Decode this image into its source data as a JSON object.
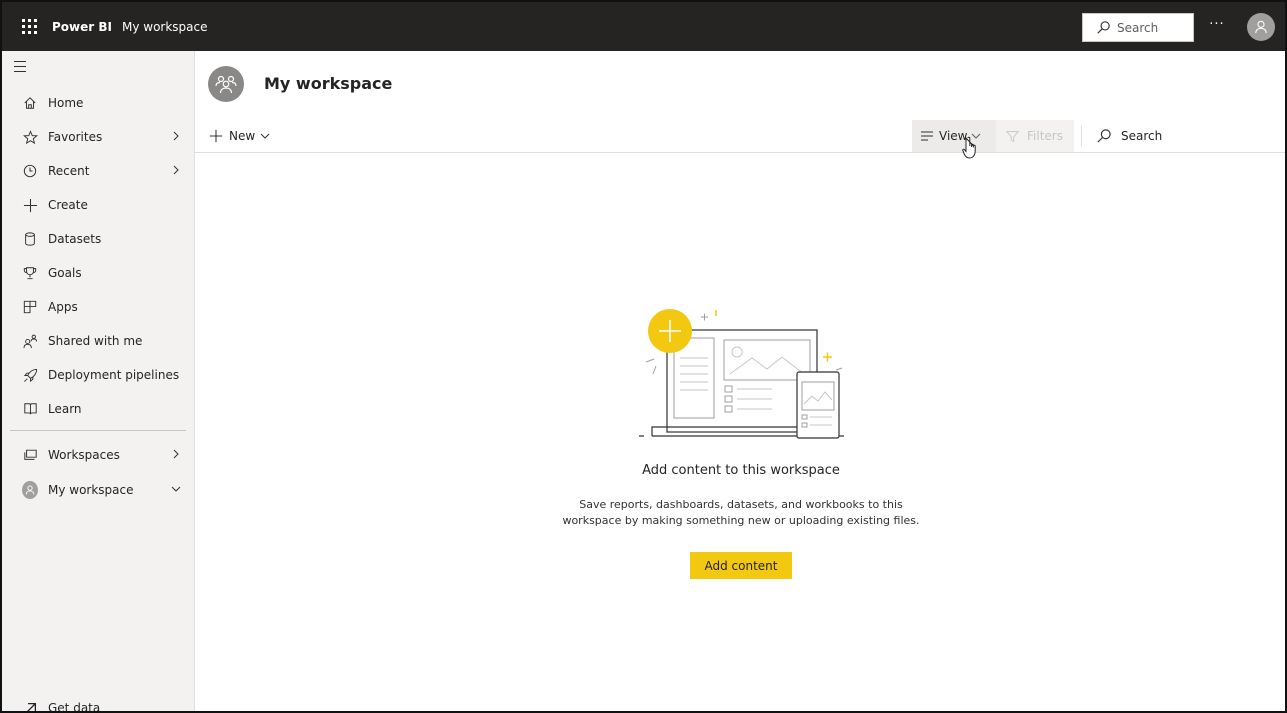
{
  "topbar": {
    "brand": "Power BI",
    "breadcrumb": "My workspace",
    "search_placeholder": "Search",
    "more": "···"
  },
  "sidebar": {
    "items": [
      {
        "label": "Home",
        "icon": "home-icon"
      },
      {
        "label": "Favorites",
        "icon": "star-icon",
        "chevron": "right"
      },
      {
        "label": "Recent",
        "icon": "clock-icon",
        "chevron": "right"
      },
      {
        "label": "Create",
        "icon": "plus-icon"
      },
      {
        "label": "Datasets",
        "icon": "database-icon"
      },
      {
        "label": "Goals",
        "icon": "trophy-icon"
      },
      {
        "label": "Apps",
        "icon": "apps-icon"
      },
      {
        "label": "Shared with me",
        "icon": "shared-icon"
      },
      {
        "label": "Deployment pipelines",
        "icon": "rocket-icon"
      },
      {
        "label": "Learn",
        "icon": "book-icon"
      }
    ],
    "workspaces_label": "Workspaces",
    "my_workspace_label": "My workspace",
    "get_data_label": "Get data"
  },
  "header": {
    "title": "My workspace"
  },
  "toolbar": {
    "new_label": "New",
    "view_label": "View",
    "filters_label": "Filters",
    "search_label": "Search"
  },
  "empty_state": {
    "title": "Add content to this workspace",
    "description_line1": "Save reports, dashboards, datasets, and workbooks to this",
    "description_line2": "workspace by making something new or uploading existing files.",
    "button_label": "Add content"
  },
  "colors": {
    "accent": "#f2c811",
    "topbar": "#252423",
    "sidebar": "#f3f2f1"
  }
}
